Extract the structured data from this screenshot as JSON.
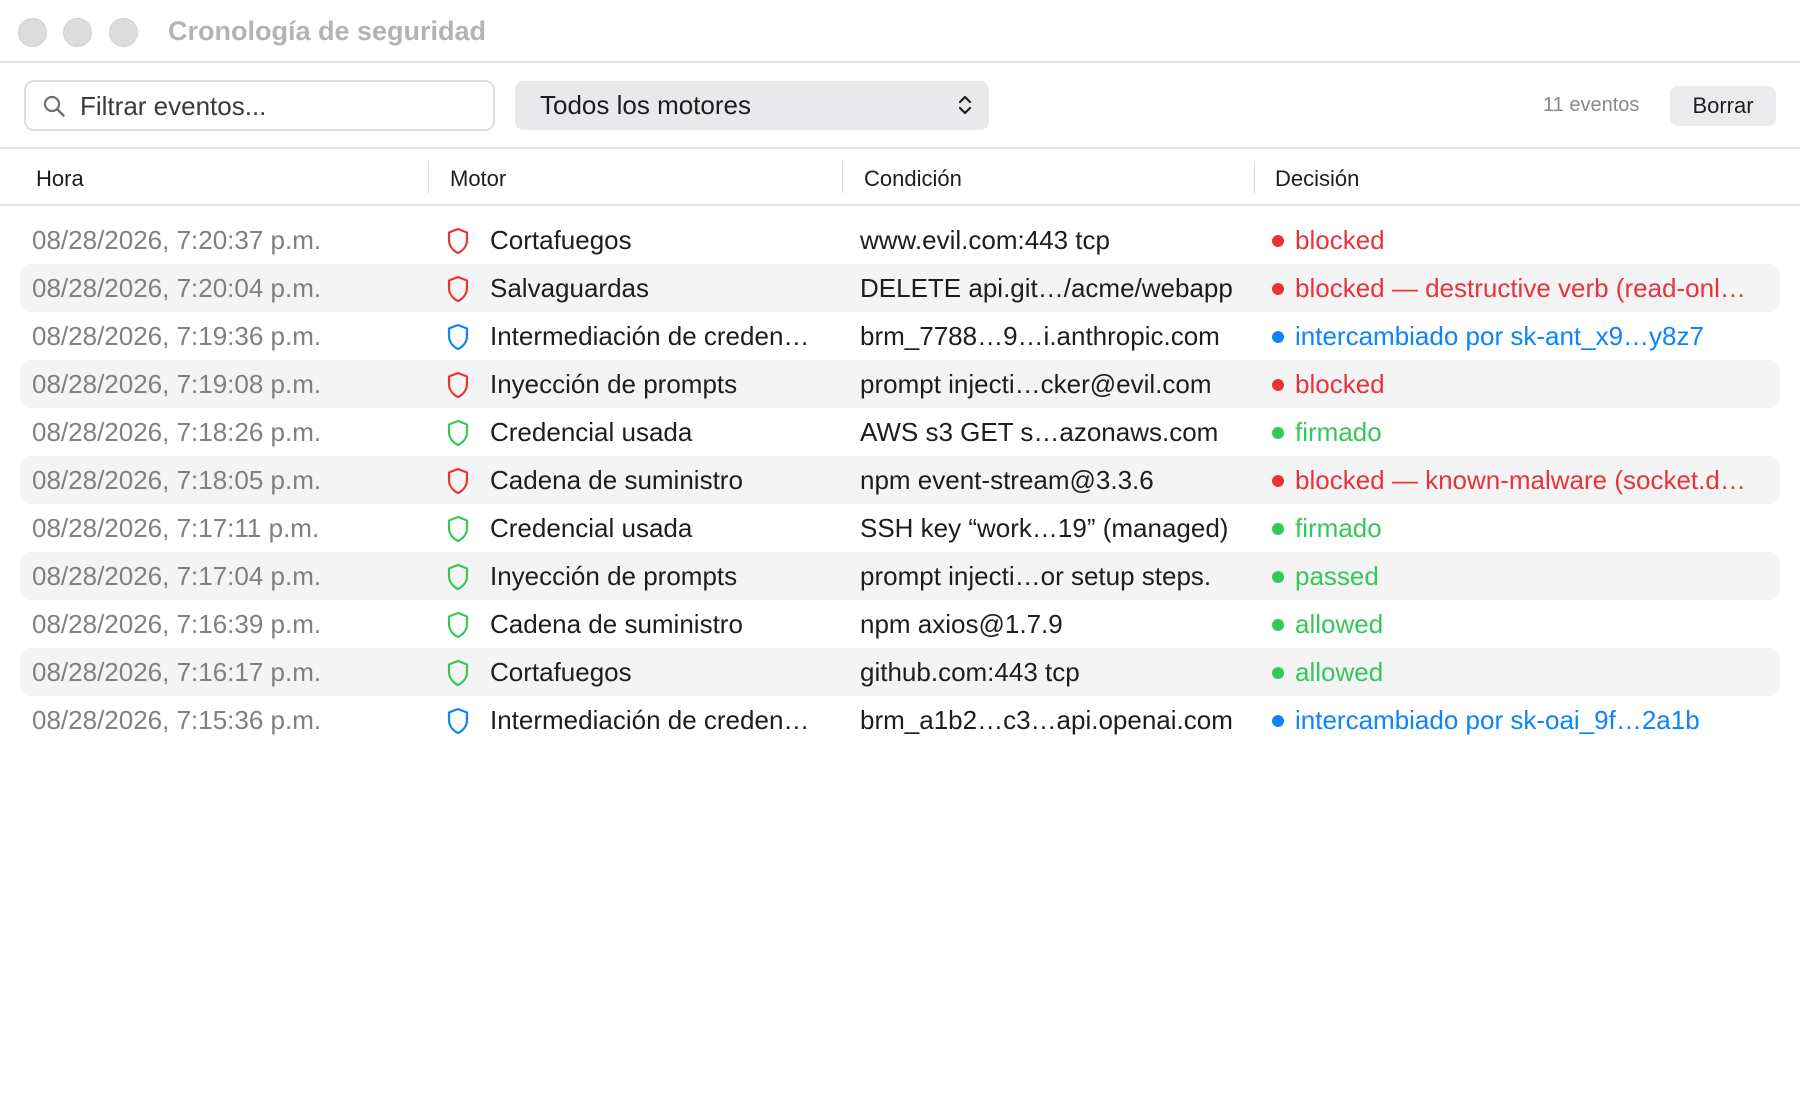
{
  "window": {
    "title": "Cronología de seguridad"
  },
  "toolbar": {
    "search_placeholder": "Filtrar eventos...",
    "engine_select": "Todos los motores",
    "event_count": "11 eventos",
    "clear_label": "Borrar"
  },
  "columns": {
    "time": "Hora",
    "engine": "Motor",
    "condition": "Condición",
    "decision": "Decisión"
  },
  "colors": {
    "red": "#e8333b",
    "green": "#34c759",
    "blue": "#0a84ff"
  },
  "events": [
    {
      "time": "08/28/2026, 7:20:37 p.m.",
      "engine": "Cortafuegos",
      "condition": "www.evil.com:443 tcp",
      "decision": "blocked",
      "status": "red"
    },
    {
      "time": "08/28/2026, 7:20:04 p.m.",
      "engine": "Salvaguardas",
      "condition": "DELETE api.git…/acme/webapp",
      "decision": "blocked — destructive verb (read-onl…",
      "status": "red"
    },
    {
      "time": "08/28/2026, 7:19:36 p.m.",
      "engine": "Intermediación de creden…",
      "condition": "brm_7788…9…i.anthropic.com",
      "decision": "intercambiado por sk-ant_x9…y8z7",
      "status": "blue"
    },
    {
      "time": "08/28/2026, 7:19:08 p.m.",
      "engine": "Inyección de prompts",
      "condition": "prompt injecti…cker@evil.com",
      "decision": "blocked",
      "status": "red"
    },
    {
      "time": "08/28/2026, 7:18:26 p.m.",
      "engine": "Credencial usada",
      "condition": "AWS s3 GET s…azonaws.com",
      "decision": "firmado",
      "status": "green"
    },
    {
      "time": "08/28/2026, 7:18:05 p.m.",
      "engine": "Cadena de suministro",
      "condition": "npm event-stream@3.3.6",
      "decision": "blocked — known-malware (socket.d…",
      "status": "red"
    },
    {
      "time": "08/28/2026, 7:17:11 p.m.",
      "engine": "Credencial usada",
      "condition": "SSH key “work…19” (managed)",
      "decision": "firmado",
      "status": "green"
    },
    {
      "time": "08/28/2026, 7:17:04 p.m.",
      "engine": "Inyección de prompts",
      "condition": "prompt injecti…or setup steps.",
      "decision": "passed",
      "status": "green"
    },
    {
      "time": "08/28/2026, 7:16:39 p.m.",
      "engine": "Cadena de suministro",
      "condition": "npm axios@1.7.9",
      "decision": "allowed",
      "status": "green"
    },
    {
      "time": "08/28/2026, 7:16:17 p.m.",
      "engine": "Cortafuegos",
      "condition": "github.com:443 tcp",
      "decision": "allowed",
      "status": "green"
    },
    {
      "time": "08/28/2026, 7:15:36 p.m.",
      "engine": "Intermediación de creden…",
      "condition": "brm_a1b2…c3…api.openai.com",
      "decision": "intercambiado por sk-oai_9f…2a1b",
      "status": "blue"
    }
  ]
}
